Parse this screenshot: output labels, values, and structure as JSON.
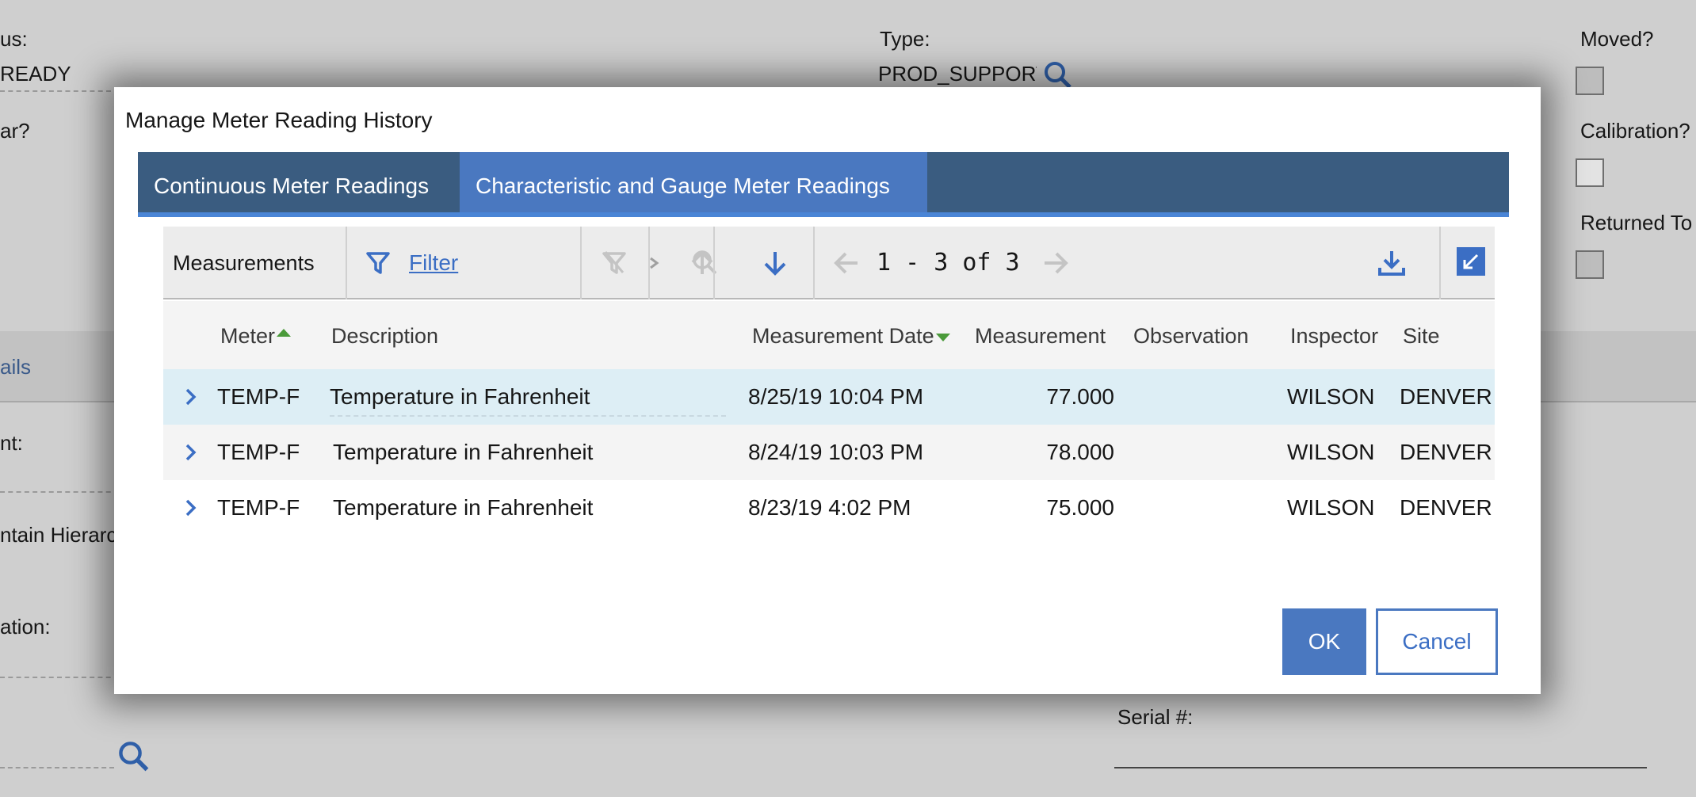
{
  "background": {
    "status_label": "us:",
    "status_value": "READY",
    "type_label": "Type:",
    "type_value": "PROD_SUPPORT",
    "moved_label": "Moved?",
    "calibration_label": "Calibration?",
    "returned_label": "Returned To",
    "ar_label": "ar?",
    "details_tab": "ails",
    "nt_label": "nt:",
    "hierarchy_label": "ntain Hierarc",
    "tion_label": "ation:",
    "serial_label": "Serial #:"
  },
  "dialog": {
    "title": "Manage Meter Reading History",
    "tabs": [
      {
        "label": "Continuous Meter Readings",
        "active": false
      },
      {
        "label": "Characteristic and Gauge Meter Readings",
        "active": true
      }
    ],
    "toolbar": {
      "section_label": "Measurements",
      "filter_label": "Filter",
      "pager_text": "1 - 3 of 3"
    },
    "columns": {
      "meter": "Meter",
      "description": "Description",
      "measurement_date": "Measurement Date",
      "measurement": "Measurement",
      "observation": "Observation",
      "inspector": "Inspector",
      "site": "Site"
    },
    "rows": [
      {
        "meter": "TEMP-F",
        "description": "Temperature in Fahrenheit",
        "date": "8/25/19 10:04 PM",
        "measurement": "77.000",
        "observation": "",
        "inspector": "WILSON",
        "site": "DENVER"
      },
      {
        "meter": "TEMP-F",
        "description": "Temperature in Fahrenheit",
        "date": "8/24/19 10:03 PM",
        "measurement": "78.000",
        "observation": "",
        "inspector": "WILSON",
        "site": "DENVER"
      },
      {
        "meter": "TEMP-F",
        "description": "Temperature in Fahrenheit",
        "date": "8/23/19 4:02 PM",
        "measurement": "75.000",
        "observation": "",
        "inspector": "WILSON",
        "site": "DENVER"
      }
    ],
    "buttons": {
      "ok": "OK",
      "cancel": "Cancel"
    }
  },
  "colors": {
    "tabbar": "#3a5c80",
    "active_tab": "#4a78c0",
    "primary": "#4a78c0",
    "selected_row": "#ddeef5"
  }
}
